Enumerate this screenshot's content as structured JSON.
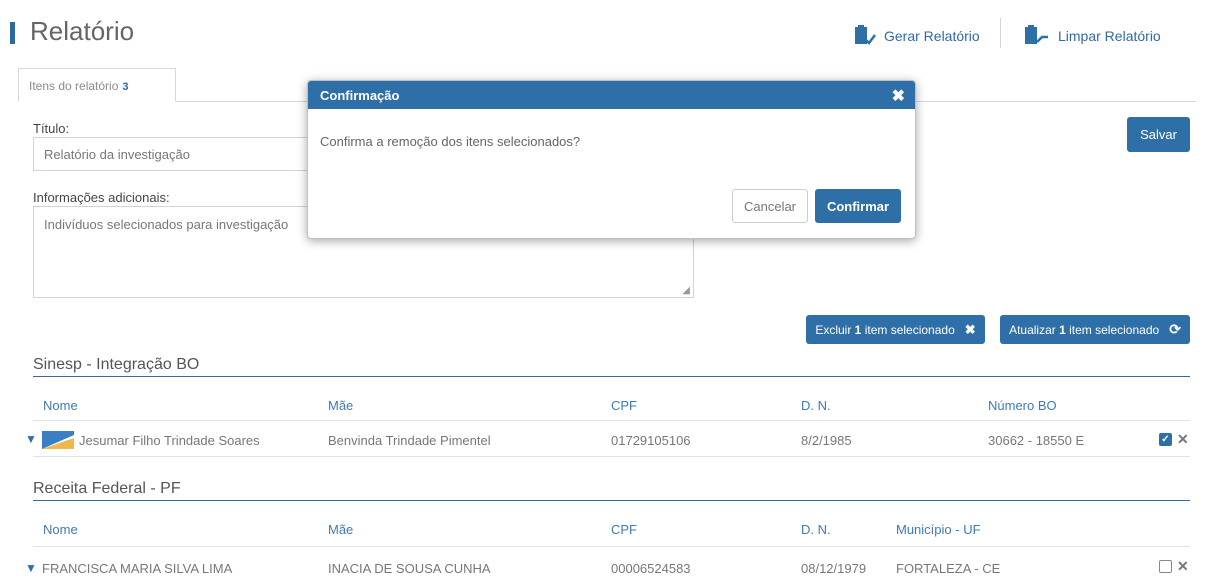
{
  "header": {
    "title": "Relatório",
    "generate_label": "Gerar Relatório",
    "clear_label": "Limpar Relatório"
  },
  "tab": {
    "label": "Itens do relatório",
    "count": "3"
  },
  "form": {
    "title_label": "Título:",
    "title_value": "Relatório da investigação",
    "info_label": "Informações adicionais:",
    "info_value": "Indivíduos selecionados para investigação",
    "save_label": "Salvar"
  },
  "actions": {
    "delete_prefix": "Excluir",
    "delete_count": "1",
    "delete_suffix": "item selecionado",
    "update_prefix": "Atualizar",
    "update_count": "1",
    "update_suffix": "item selecionado"
  },
  "sections": [
    {
      "title": "Sinesp - Integração BO",
      "columns": [
        "Nome",
        "Mãe",
        "CPF",
        "D. N.",
        "Número BO"
      ],
      "rows": [
        {
          "name": "Jesumar Filho Trindade Soares",
          "mother": "Benvinda Trindade Pimentel",
          "cpf": "01729105106",
          "dob": "8/2/1985",
          "extra": "30662 - 18550 E",
          "checked": true
        }
      ]
    },
    {
      "title": "Receita Federal - PF",
      "columns": [
        "Nome",
        "Mãe",
        "CPF",
        "D. N.",
        "Município - UF"
      ],
      "rows": [
        {
          "name": "FRANCISCA MARIA SILVA LIMA",
          "mother": "INACIA DE SOUSA CUNHA",
          "cpf": "00006524583",
          "dob": "08/12/1979",
          "extra": "FORTALEZA - CE",
          "checked": false
        }
      ]
    }
  ],
  "modal": {
    "title": "Confirmação",
    "message": "Confirma a remoção dos itens selecionados?",
    "cancel_label": "Cancelar",
    "confirm_label": "Confirmar"
  },
  "colors": {
    "primary": "#2f6fa7",
    "accent_text": "#3f7ab8"
  },
  "icons": {
    "generate": "document-add-icon",
    "clear": "document-clear-icon",
    "delete": "close-icon",
    "update": "refresh-icon",
    "close": "close-icon",
    "expand": "chevron-down-icon",
    "flag": "flag-icon"
  }
}
